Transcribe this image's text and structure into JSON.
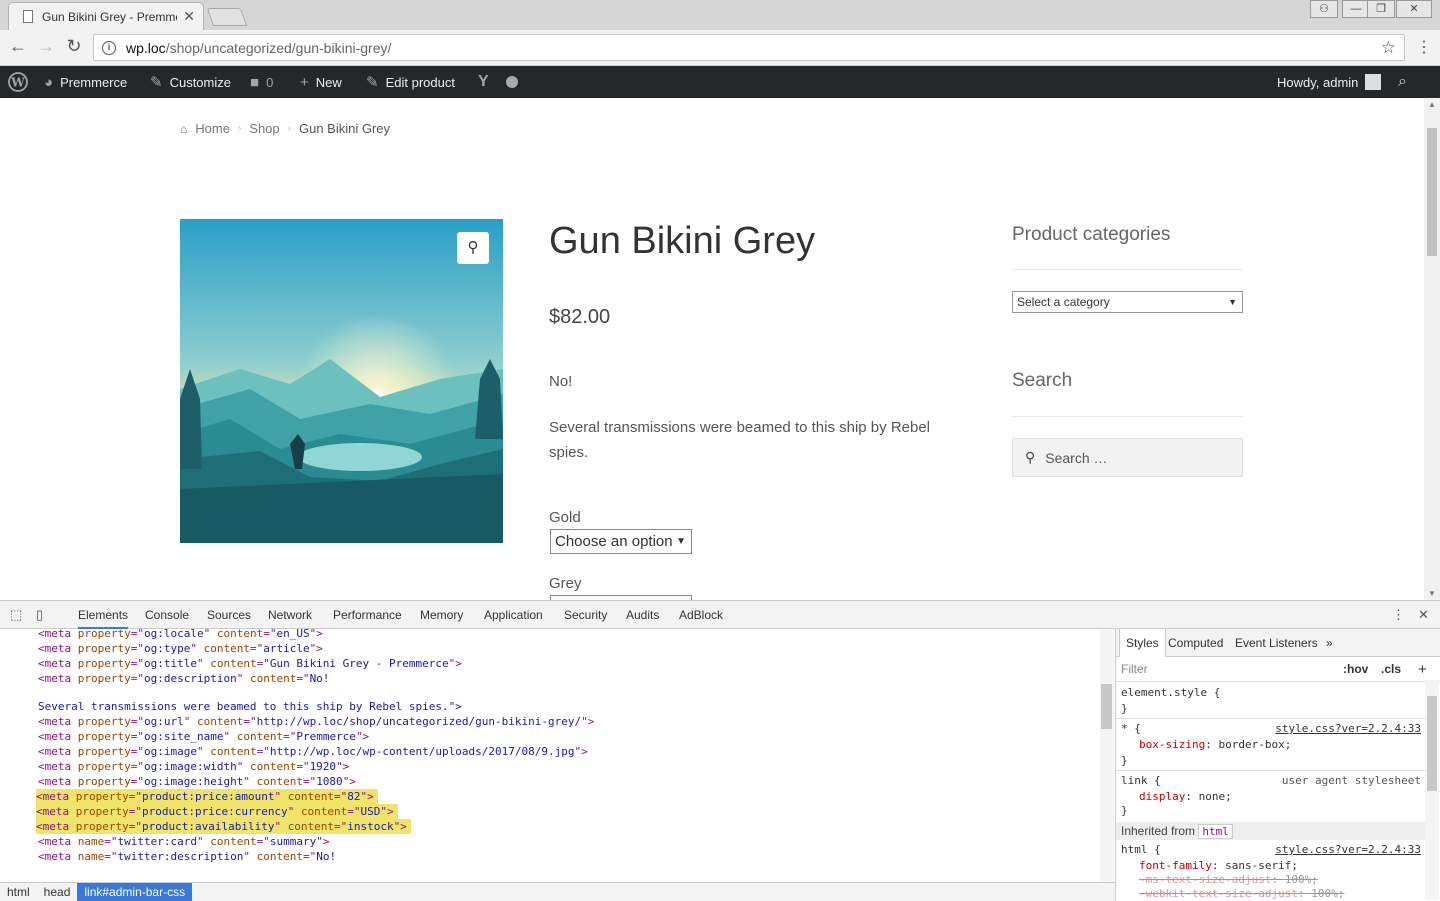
{
  "browser": {
    "tab_title": "Gun Bikini Grey - Premmerce",
    "tab_close": "✕",
    "url_domain": "wp.loc",
    "url_path": "/shop/uncategorized/gun-bikini-grey/"
  },
  "adminbar": {
    "site_name": "Premmerce",
    "customize": "Customize",
    "comments_count": "0",
    "new": "New",
    "edit_product": "Edit product",
    "howdy": "Howdy, admin"
  },
  "breadcrumb": [
    "Home",
    "Shop",
    "Gun Bikini Grey"
  ],
  "product": {
    "title": "Gun Bikini Grey",
    "price": "$82.00",
    "short_description": "No!",
    "description": "Several transmissions were beamed to this ship by Rebel spies.",
    "variation1_label": "Gold",
    "variation1_value": "Choose an option",
    "variation2_label": "Grey"
  },
  "sidebar": {
    "categories_title": "Product categories",
    "categories_select": "Select a category",
    "search_title": "Search",
    "search_placeholder": "Search …"
  },
  "devtools": {
    "tabs": [
      "Elements",
      "Console",
      "Sources",
      "Network",
      "Performance",
      "Memory",
      "Application",
      "Security",
      "Audits",
      "AdBlock"
    ],
    "dom_lines": [
      {
        "p": "og:locale",
        "c": "en_US",
        "k": "property"
      },
      {
        "p": "og:type",
        "c": "article",
        "k": "property"
      },
      {
        "p": "og:title",
        "c": "Gun Bikini Grey - Premmerce",
        "k": "property"
      },
      {
        "p": "og:description",
        "c": "No!",
        "k": "property",
        "open": true
      }
    ],
    "dom_text": "Several transmissions were beamed to this ship by Rebel spies.\">",
    "dom_lines2": [
      {
        "p": "og:url",
        "c": "http://wp.loc/shop/uncategorized/gun-bikini-grey/",
        "k": "property"
      },
      {
        "p": "og:site_name",
        "c": "Premmerce",
        "k": "property"
      },
      {
        "p": "og:image",
        "c": "http://wp.loc/wp-content/uploads/2017/08/9.jpg",
        "k": "property"
      },
      {
        "p": "og:image:width",
        "c": "1920",
        "k": "property"
      },
      {
        "p": "og:image:height",
        "c": "1080",
        "k": "property"
      },
      {
        "p": "product:price:amount",
        "c": "82",
        "k": "property",
        "hl": true
      },
      {
        "p": "product:price:currency",
        "c": "USD",
        "k": "property",
        "hl": true
      },
      {
        "p": "product:availability",
        "c": "instock",
        "k": "property",
        "hl": true
      },
      {
        "p": "twitter:card",
        "c": "summary",
        "k": "name"
      },
      {
        "p": "twitter:description",
        "c": "No!",
        "k": "name",
        "open": true
      }
    ],
    "crumbs": [
      "html",
      "head",
      "link#admin-bar-css"
    ],
    "styles_tabs": [
      "Styles",
      "Computed",
      "Event Listeners"
    ],
    "filter": "Filter",
    "hov": ":hov",
    "cls": ".cls",
    "rules": {
      "element_style": "element.style {",
      "close": "}",
      "star_sel": "* {",
      "star_src": "style.css?ver=2.2.4:33",
      "star_prop": "box-sizing",
      "star_val": "border-box;",
      "link_sel": "link {",
      "link_src": "user agent stylesheet",
      "link_prop": "display",
      "link_val": "none;",
      "inherited_label": "Inherited from",
      "inherited_tag": "html",
      "html_sel": "html {",
      "html_src": "style.css?ver=2.2.4:33",
      "html_prop1": "font-family",
      "html_val1": "sans-serif;",
      "html_prop2": "-ms-text-size-adjust",
      "html_val2": "100%;",
      "html_prop3": "-webkit-text-size-adjust",
      "html_val3": "100%;"
    }
  }
}
